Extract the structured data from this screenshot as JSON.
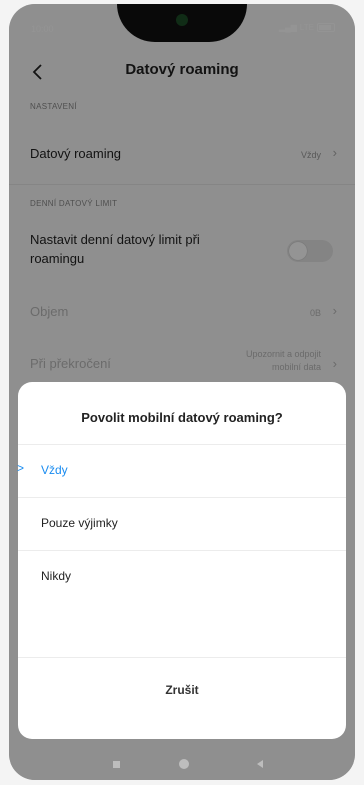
{
  "status": {
    "time": "10:00",
    "network": "LTE"
  },
  "header": {
    "title": "Datový roaming"
  },
  "sections": {
    "nastaveni": "NASTAVENÍ",
    "denni": "DENNÍ DATOVÝ LIMIT"
  },
  "rows": {
    "roaming": {
      "label": "Datový roaming",
      "value": "Vždy"
    },
    "limit": {
      "label_line1": "Nastavit denní datový limit při",
      "label_line2": "roamingu",
      "toggle_on": false
    },
    "objem": {
      "label": "Objem",
      "value": "0B"
    },
    "prekroceni": {
      "label": "Při překročení",
      "value_line1": "Upozornit a odpojit",
      "value_line2": "mobilní data"
    }
  },
  "dialog": {
    "title": "Povolit mobilní datový roaming?",
    "options": [
      {
        "label": "Vždy",
        "selected": true
      },
      {
        "label": "Pouze výjimky",
        "selected": false
      },
      {
        "label": "Nikdy",
        "selected": false
      }
    ],
    "selected_mark": ">",
    "cancel": "Zrušit"
  },
  "colors": {
    "accent": "#1a8cf0",
    "scrim": "#000000"
  }
}
